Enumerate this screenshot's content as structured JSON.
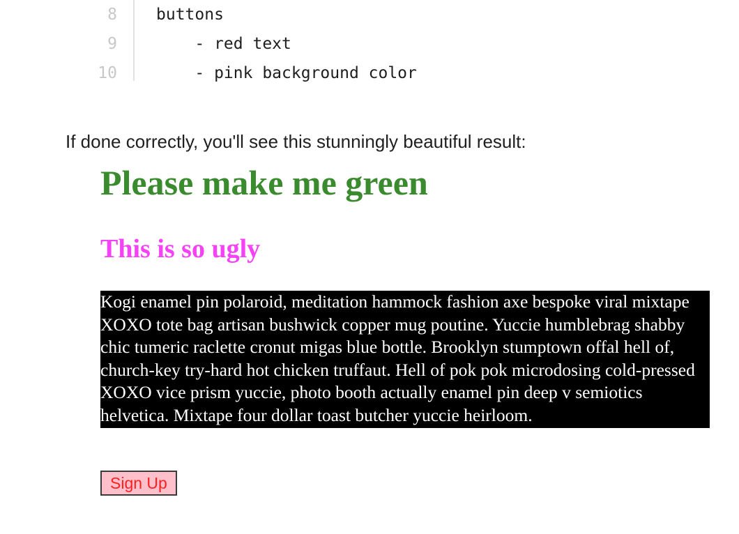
{
  "code": {
    "lines": [
      {
        "number": "8",
        "text": "buttons"
      },
      {
        "number": "9",
        "text": "    - red text"
      },
      {
        "number": "10",
        "text": "    - pink background color"
      }
    ]
  },
  "intro": {
    "text": "If done correctly, you'll see this stunningly beautiful result:"
  },
  "demo": {
    "heading_green": "Please make me green",
    "heading_pink": "This is so ugly",
    "paragraph": "Kogi enamel pin polaroid, meditation hammock fashion axe bespoke viral mixtape XOXO tote bag artisan bushwick copper mug poutine. Yuccie humblebrag shabby chic tumeric raclette cronut migas blue bottle. Brooklyn stumptown offal hell of, church-key try-hard hot chicken truffaut. Hell of pok pok microdosing cold-pressed XOXO vice prism yuccie, photo booth actually enamel pin deep v semiotics helvetica. Mixtape four dollar toast butcher yuccie heirloom.",
    "button_label": "Sign Up"
  },
  "colors": {
    "green_heading": "#3a8a2e",
    "pink_heading": "#f542f5",
    "paragraph_background": "#000000",
    "paragraph_text": "#ffffff",
    "button_background": "#ffc0cb",
    "button_text": "#ff1f1f"
  }
}
